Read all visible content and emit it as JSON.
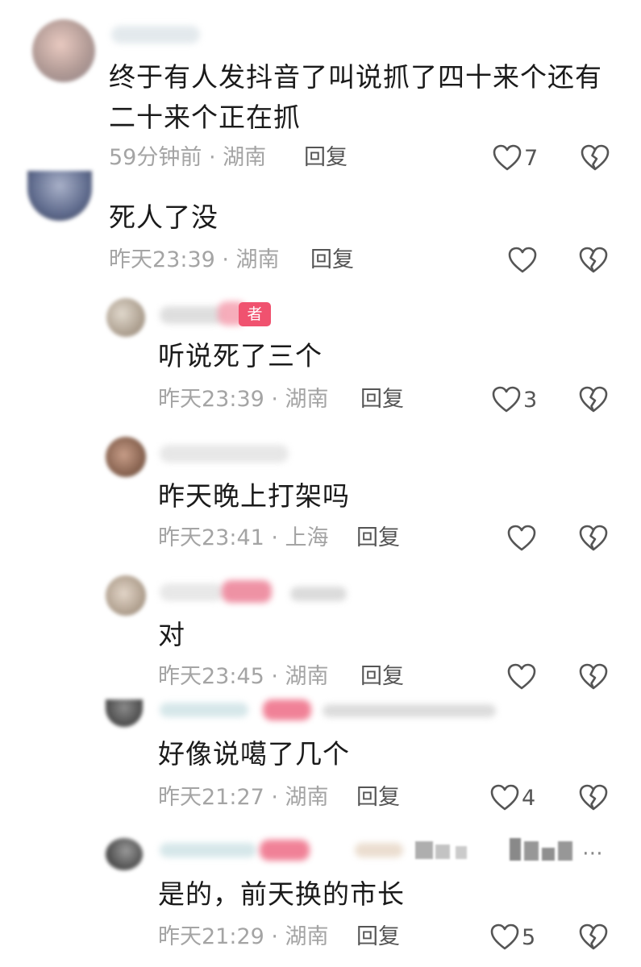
{
  "comments": [
    {
      "text": [
        "终于有人发抖音了叫说抓了四十来个还有",
        "二十来个正在抓"
      ],
      "meta": "59分钟前 · 湖南",
      "reply": "回复",
      "likes": "7"
    },
    {
      "text": [
        "死人了没"
      ],
      "meta": "昨天23:39 · 湖南",
      "reply": "回复",
      "likes": ""
    },
    {
      "badge": "者",
      "text": [
        "听说死了三个"
      ],
      "meta": "昨天23:39 · 湖南",
      "reply": "回复",
      "likes": "3"
    },
    {
      "text": [
        "昨天晚上打架吗"
      ],
      "meta": "昨天23:41 · 上海",
      "reply": "回复",
      "likes": ""
    },
    {
      "text": [
        "对"
      ],
      "meta": "昨天23:45 · 湖南",
      "reply": "回复",
      "likes": ""
    },
    {
      "text": [
        "好像说噶了几个"
      ],
      "meta": "昨天21:27 · 湖南",
      "reply": "回复",
      "likes": "4"
    },
    {
      "text": [
        "是的，前天换的市长"
      ],
      "meta": "昨天21:29 · 湖南",
      "reply": "回复",
      "likes": "5"
    }
  ],
  "icons": {
    "like": "heart-outline-icon",
    "dislike": "broken-heart-icon"
  },
  "colors": {
    "badge": "#f0526f",
    "meta": "#a4a4a4"
  }
}
